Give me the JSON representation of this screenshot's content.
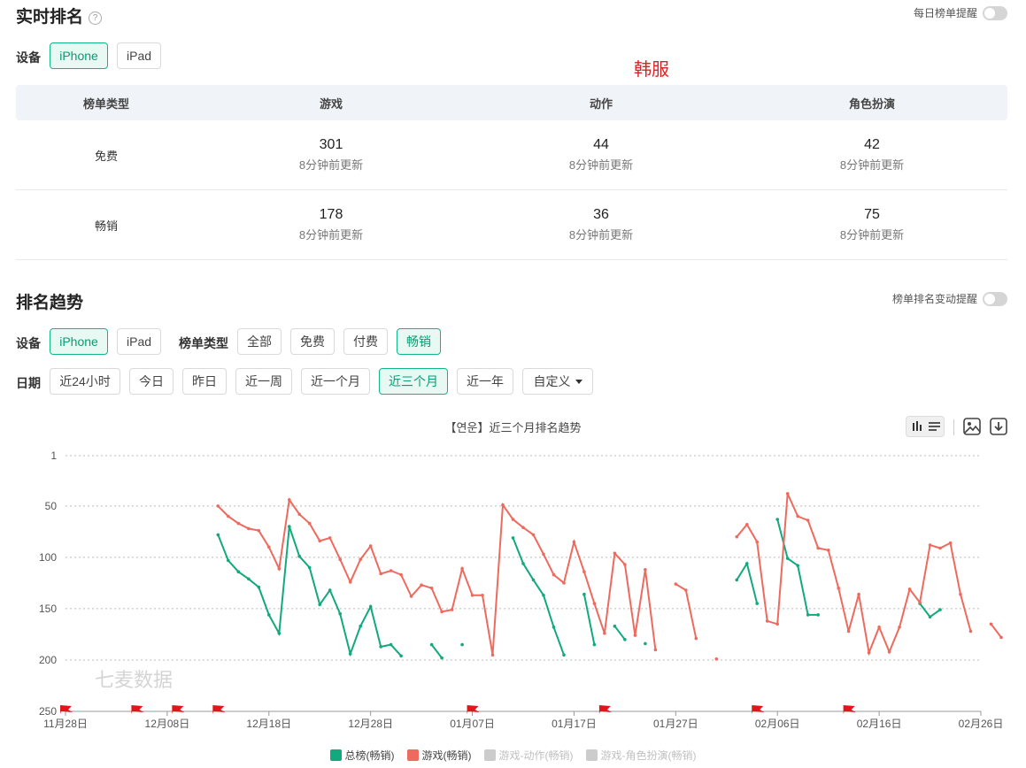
{
  "realtime": {
    "title": "实时排名",
    "help": "?",
    "daily_toggle_label": "每日榜单提醒",
    "device_label": "设备",
    "devices": [
      "iPhone",
      "iPad"
    ],
    "region_label": "韩服",
    "table": {
      "headers": [
        "榜单类型",
        "游戏",
        "动作",
        "角色扮演"
      ],
      "rows": [
        {
          "type": "免费",
          "cells": [
            {
              "value": "301",
              "updated": "8分钟前更新"
            },
            {
              "value": "44",
              "updated": "8分钟前更新"
            },
            {
              "value": "42",
              "updated": "8分钟前更新"
            }
          ]
        },
        {
          "type": "畅销",
          "cells": [
            {
              "value": "178",
              "updated": "8分钟前更新"
            },
            {
              "value": "36",
              "updated": "8分钟前更新"
            },
            {
              "value": "75",
              "updated": "8分钟前更新"
            }
          ]
        }
      ]
    }
  },
  "trend": {
    "title": "排名趋势",
    "change_toggle_label": "榜单排名变动提醒",
    "device_label": "设备",
    "devices": [
      "iPhone",
      "iPad"
    ],
    "list_type_label": "榜单类型",
    "list_types": [
      "全部",
      "免费",
      "付费",
      "畅销"
    ],
    "date_label": "日期",
    "dates": [
      "近24小时",
      "今日",
      "昨日",
      "近一周",
      "近一个月",
      "近三个月",
      "近一年",
      "自定义"
    ]
  },
  "colors": {
    "accent": "#10b68a",
    "series_total": "#12a97d",
    "series_game": "#ee6a5f",
    "inactive": "#cccccc",
    "flag": "#e0161b"
  },
  "icons": {
    "chart_mode": "bar-chart-icon",
    "table_mode": "list-icon",
    "save_image": "image-icon",
    "download": "download-icon",
    "help": "question-circle-icon",
    "dropdown": "caret-down-icon",
    "event_marker": "flag-icon"
  },
  "chart_data": {
    "type": "line",
    "title": "【연운】近三个月排名趋势",
    "watermark": "七麦数据",
    "y_inverted": true,
    "ylim": [
      1,
      250
    ],
    "y_ticks": [
      1,
      50,
      100,
      150,
      200,
      250
    ],
    "x_tick_labels": [
      "11月28日",
      "12月08日",
      "12月18日",
      "12月28日",
      "01月07日",
      "01月17日",
      "01月27日",
      "02月06日",
      "02月16日",
      "02月26日"
    ],
    "x_range": [
      "11月28日",
      "02月26日"
    ],
    "grid": "horizontal dotted",
    "legend_position": "bottom",
    "event_flags": [
      "11月28日",
      "12月05日",
      "12月09日",
      "12月13日",
      "01月07日",
      "01月20日",
      "02月04日",
      "02月13日"
    ],
    "series": [
      {
        "name": "总榜(畅销)",
        "color": "#12a97d",
        "points": [
          [
            "12月13日",
            78
          ],
          [
            "12月14日",
            103
          ],
          [
            "12月15日",
            114
          ],
          [
            "12月16日",
            121
          ],
          [
            "12月17日",
            129
          ],
          [
            "12月18日",
            156
          ],
          [
            "12月19日",
            174
          ],
          [
            "12月20日",
            70
          ],
          [
            "12月21日",
            99
          ],
          [
            "12月22日",
            110
          ],
          [
            "12月23日",
            146
          ],
          [
            "12月24日",
            132
          ],
          [
            "12月25日",
            155
          ],
          [
            "12月26日",
            194
          ],
          [
            "12月27日",
            167
          ],
          [
            "12月28日",
            148
          ],
          [
            "12月29日",
            187
          ],
          [
            "12月30日",
            185
          ],
          [
            "12月31日",
            196
          ],
          null,
          [
            "01月03日",
            185
          ],
          [
            "01月04日",
            198
          ],
          null,
          [
            "01月06日",
            185
          ],
          null,
          [
            "01月11日",
            81
          ],
          [
            "01月12日",
            106
          ],
          [
            "01月13日",
            122
          ],
          [
            "01月14日",
            137
          ],
          [
            "01月15日",
            168
          ],
          [
            "01月16日",
            195
          ],
          null,
          [
            "01月18日",
            136
          ],
          [
            "01月19日",
            185
          ],
          null,
          [
            "01月21日",
            167
          ],
          [
            "01月22日",
            180
          ],
          null,
          [
            "01月24日",
            184
          ],
          null,
          [
            "02月02日",
            122
          ],
          [
            "02月03日",
            106
          ],
          [
            "02月04日",
            145
          ],
          null,
          [
            "02月06日",
            63
          ],
          [
            "02月07日",
            101
          ],
          [
            "02月08日",
            108
          ],
          [
            "02月09日",
            156
          ],
          [
            "02月10日",
            156
          ],
          null,
          [
            "02月20日",
            145
          ],
          [
            "02月21日",
            158
          ],
          [
            "02月22日",
            151
          ]
        ]
      },
      {
        "name": "游戏(畅销)",
        "color": "#ee6a5f",
        "points": [
          [
            "12月13日",
            50
          ],
          [
            "12月14日",
            60
          ],
          [
            "12月15日",
            67
          ],
          [
            "12月16日",
            72
          ],
          [
            "12月17日",
            74
          ],
          [
            "12月18日",
            90
          ],
          [
            "12月19日",
            111
          ],
          [
            "12月20日",
            44
          ],
          [
            "12月21日",
            58
          ],
          [
            "12月22日",
            67
          ],
          [
            "12月23日",
            84
          ],
          [
            "12月24日",
            81
          ],
          [
            "12月25日",
            102
          ],
          [
            "12月26日",
            124
          ],
          [
            "12月27日",
            102
          ],
          [
            "12月28日",
            89
          ],
          [
            "12月29日",
            116
          ],
          [
            "12月30日",
            113
          ],
          [
            "12月31日",
            117
          ],
          [
            "01月01日",
            138
          ],
          [
            "01月02日",
            127
          ],
          [
            "01月03日",
            130
          ],
          [
            "01月04日",
            153
          ],
          [
            "01月05日",
            151
          ],
          [
            "01月06日",
            111
          ],
          [
            "01月07日",
            137
          ],
          [
            "01月08日",
            137
          ],
          [
            "01月09日",
            195
          ],
          [
            "01月10日",
            49
          ],
          [
            "01月11日",
            63
          ],
          [
            "01月12日",
            71
          ],
          [
            "01月13日",
            78
          ],
          [
            "01月14日",
            97
          ],
          [
            "01月15日",
            117
          ],
          [
            "01月16日",
            125
          ],
          [
            "01月17日",
            85
          ],
          [
            "01月18日",
            114
          ],
          [
            "01月19日",
            145
          ],
          [
            "01月20日",
            174
          ],
          [
            "01月21日",
            96
          ],
          [
            "01月22日",
            107
          ],
          [
            "01月23日",
            176
          ],
          [
            "01月24日",
            112
          ],
          [
            "01月25日",
            190
          ],
          null,
          [
            "01月27日",
            126
          ],
          [
            "01月28日",
            132
          ],
          [
            "01月29日",
            179
          ],
          null,
          [
            "01月31日",
            199
          ],
          null,
          [
            "02月02日",
            80
          ],
          [
            "02月03日",
            68
          ],
          [
            "02月04日",
            85
          ],
          [
            "02月05日",
            162
          ],
          [
            "02月06日",
            165
          ],
          [
            "02月07日",
            38
          ],
          [
            "02月08日",
            60
          ],
          [
            "02月09日",
            64
          ],
          [
            "02月10日",
            91
          ],
          [
            "02月11日",
            93
          ],
          [
            "02月12日",
            130
          ],
          [
            "02月13日",
            172
          ],
          [
            "02月14日",
            136
          ],
          [
            "02月15日",
            193
          ],
          [
            "02月16日",
            168
          ],
          [
            "02月17日",
            192
          ],
          [
            "02月18日",
            168
          ],
          [
            "02月19日",
            131
          ],
          [
            "02月20日",
            144
          ],
          [
            "02月21日",
            88
          ],
          [
            "02月22日",
            91
          ],
          [
            "02月23日",
            86
          ],
          [
            "02月24日",
            136
          ],
          [
            "02月25日",
            172
          ],
          null,
          [
            "02月27日",
            165
          ],
          [
            "02月28日",
            178
          ]
        ]
      },
      {
        "name": "游戏-动作(畅销)",
        "color": "#cccccc",
        "points": []
      },
      {
        "name": "游戏-角色扮演(畅销)",
        "color": "#cccccc",
        "points": []
      }
    ]
  }
}
